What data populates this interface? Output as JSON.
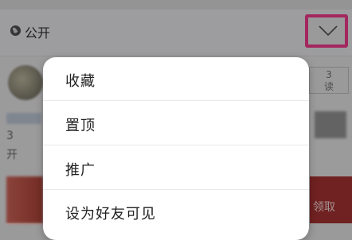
{
  "privacy": {
    "label": "公开",
    "globe_icon": "globe-icon",
    "dropdown_icon": "chevron-down-icon"
  },
  "background": {
    "count_label": "3",
    "count_suffix": "读",
    "left_text_1": "3",
    "left_text_2": "开",
    "redeem_label": "领取"
  },
  "menu": {
    "items": [
      {
        "label": "收藏"
      },
      {
        "label": "置顶"
      },
      {
        "label": "推广"
      },
      {
        "label": "设为好友可见"
      }
    ]
  },
  "colors": {
    "highlight": "#ff3d93",
    "overlay": "rgba(0,0,0,0.36)"
  }
}
